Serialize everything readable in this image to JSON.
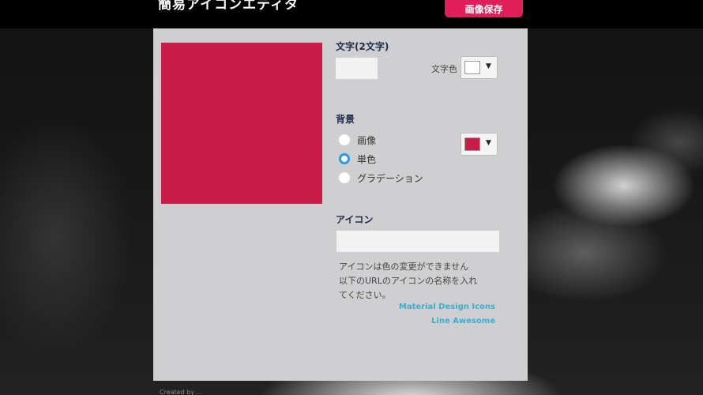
{
  "header": {
    "title": "簡易アイコンエディタ",
    "save_label": "画像保存"
  },
  "preview": {
    "color": "#c91c48"
  },
  "text_section": {
    "label": "文字(2文字)",
    "value": "",
    "text_color_label": "文字色",
    "text_color": "#ffffff",
    "arrow": "▼"
  },
  "background_section": {
    "label": "背景",
    "options": [
      {
        "label": "画像",
        "checked": false
      },
      {
        "label": "単色",
        "checked": true
      },
      {
        "label": "グラデーション",
        "checked": false
      }
    ],
    "color": "#c91c48",
    "arrow": "▼"
  },
  "icon_section": {
    "label": "アイコン",
    "value": "",
    "help_lines": [
      "アイコンは色の変更ができません",
      "以下のURLのアイコンの名称を入れ",
      "てください。"
    ],
    "links": [
      "Material Design Icons",
      "Line Awesome"
    ],
    "link_color": "#3aaecc"
  },
  "footer": {
    "text": "Created by ..."
  },
  "colors": {
    "accent": "#e01e5a",
    "panel": "#cfcfd1",
    "label": "#1e2a4a"
  }
}
